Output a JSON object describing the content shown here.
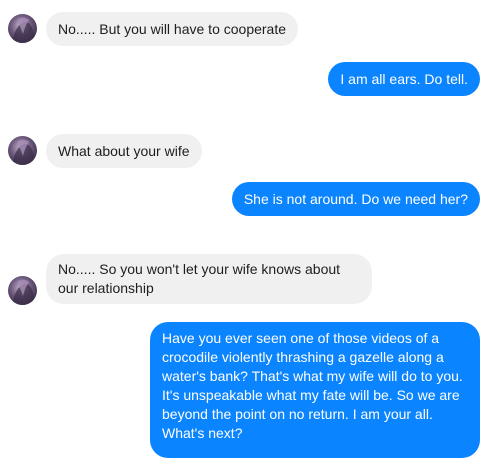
{
  "colors": {
    "incoming_bubble": "#f1f0f0",
    "outgoing_bubble": "#0a84ff",
    "outgoing_text": "#ffffff",
    "incoming_text": "#1c1e21"
  },
  "messages": [
    {
      "sender": "contact",
      "text": "No..... But you will have to cooperate"
    },
    {
      "sender": "me",
      "text": "I am all ears. Do tell."
    },
    {
      "sender": "contact",
      "text": "What about your wife"
    },
    {
      "sender": "me",
      "text": "She is not around. Do we need her?"
    },
    {
      "sender": "contact",
      "text": "No..... So you won't let your wife knows about our relationship"
    },
    {
      "sender": "me",
      "text": "Have you ever seen one of those videos of a crocodile violently thrashing a gazelle along a water's bank? That's what my wife will do to you. It's unspeakable what my fate will be. So we are beyond the point on no return. I am your all. What's next?"
    }
  ],
  "avatar": {
    "icon": "contact-avatar-photo"
  }
}
